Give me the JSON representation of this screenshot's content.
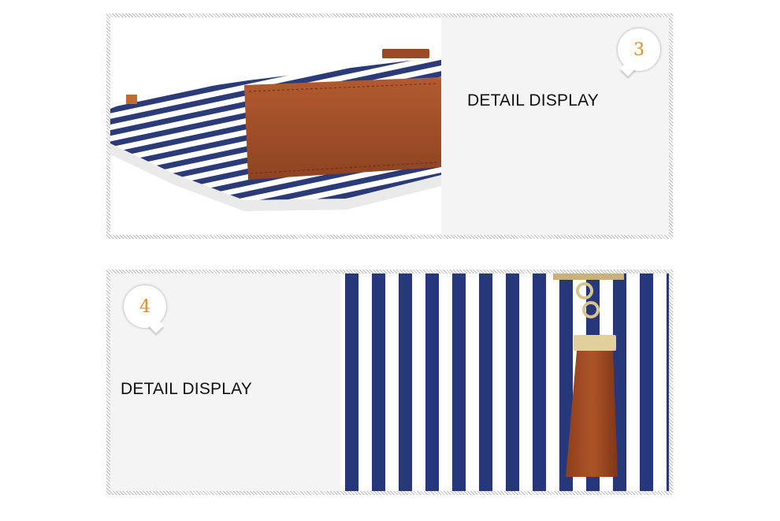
{
  "panels": [
    {
      "number": "3",
      "caption": "DETAIL DISPLAY"
    },
    {
      "number": "4",
      "caption": "DETAIL DISPLAY"
    }
  ],
  "colors": {
    "number_accent": "#ee8a1e",
    "stripe_navy": "#2b3a78",
    "leather_brown": "#a9532b",
    "panel_gray": "#f4f4f4"
  }
}
